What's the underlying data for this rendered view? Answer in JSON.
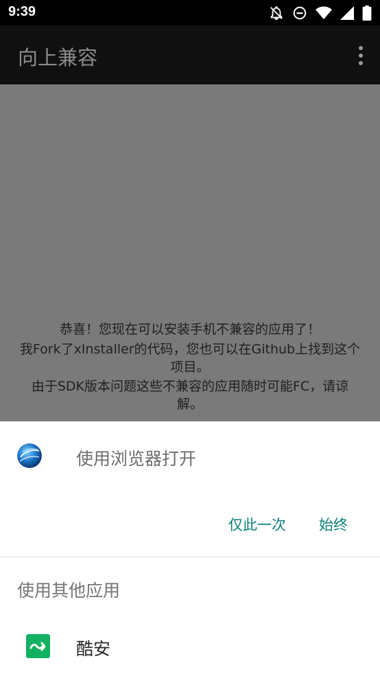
{
  "status_bar": {
    "time": "9:39",
    "icons": [
      "notifications-off-icon",
      "do-not-disturb-icon",
      "wifi-icon",
      "signal-icon",
      "battery-icon"
    ]
  },
  "app_bar": {
    "title": "向上兼容",
    "overflow_icon": "more-vert-icon"
  },
  "content": {
    "lines": [
      "恭喜！您现在可以安装手机不兼容的应用了！",
      "我Fork了xInstaller的代码，您也可以在Github上找到这个",
      "项目。",
      "由于SDK版本问题这些不兼容的应用随时可能FC，请谅",
      "解。"
    ]
  },
  "chooser": {
    "default_app_label": "使用浏览器打开",
    "default_app_icon": "browser-globe-icon",
    "just_once_label": "仅此一次",
    "always_label": "始终",
    "other_apps_label": "使用其他应用",
    "apps": [
      {
        "label": "酷安",
        "icon": "coolapk-icon"
      }
    ]
  },
  "colors": {
    "accent": "#0a7f79",
    "coolapk_green": "#11b161",
    "scrim_gray": "#7a7a7a",
    "appbar": "#101010"
  }
}
